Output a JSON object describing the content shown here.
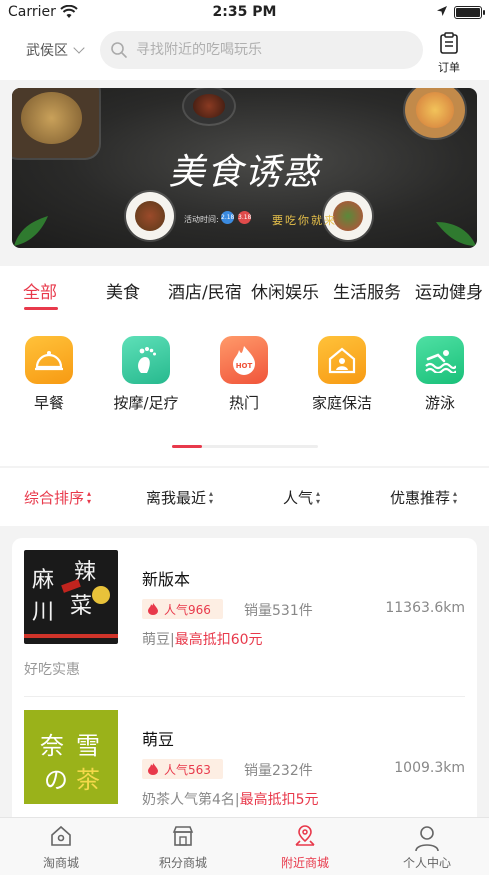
{
  "status_bar": {
    "carrier": "Carrier",
    "time": "2:35 PM"
  },
  "header": {
    "district": "武侯区",
    "search_placeholder": "寻找附近的吃喝玩乐",
    "orders_label": "订单"
  },
  "banner": {
    "title": "美食诱惑",
    "time_label": "活动时间:",
    "date_start": "2.18",
    "date_end": "3.18",
    "tagline": "要吃你就来"
  },
  "categories": {
    "tabs": [
      "全部",
      "美食",
      "酒店/民宿",
      "休闲娱乐",
      "生活服务",
      "运动健身"
    ],
    "active_index": 0
  },
  "services": [
    {
      "label": "早餐",
      "icon": "breakfast-icon",
      "color": "#f7a51c"
    },
    {
      "label": "按摩/足疗",
      "icon": "foot-icon",
      "color": "#3ac8a0"
    },
    {
      "label": "热门",
      "icon": "hot-icon",
      "color": "#f2663f"
    },
    {
      "label": "家庭保洁",
      "icon": "house-icon",
      "color": "#f7a51c"
    },
    {
      "label": "游泳",
      "icon": "swim-icon",
      "color": "#2fcf8b"
    }
  ],
  "sort_options": [
    "综合排序",
    "离我最近",
    "人气",
    "优惠推荐"
  ],
  "shops": [
    {
      "name": "新版本",
      "popularity": "人气966",
      "sales": "销量531件",
      "distance": "11363.6km",
      "tag": "萌豆|",
      "discount": "最高抵扣60元",
      "note": "好吃实惠",
      "thumb_text": [
        "麻",
        "辣",
        "川",
        "菜"
      ]
    },
    {
      "name": "萌豆",
      "popularity": "人气563",
      "sales": "销量232件",
      "distance": "1009.3km",
      "tag": "奶茶人气第4名|",
      "discount": "最高抵扣5元",
      "thumb_text": [
        "奈",
        "雪",
        "の",
        "茶"
      ]
    }
  ],
  "bottom_nav": [
    {
      "label": "淘商城",
      "icon": "home-icon"
    },
    {
      "label": "积分商城",
      "icon": "store-icon"
    },
    {
      "label": "附近商城",
      "icon": "map-pin-icon"
    },
    {
      "label": "个人中心",
      "icon": "user-icon"
    }
  ],
  "colors": {
    "accent": "#e8394b",
    "discount_bg": "#fdeee3"
  }
}
